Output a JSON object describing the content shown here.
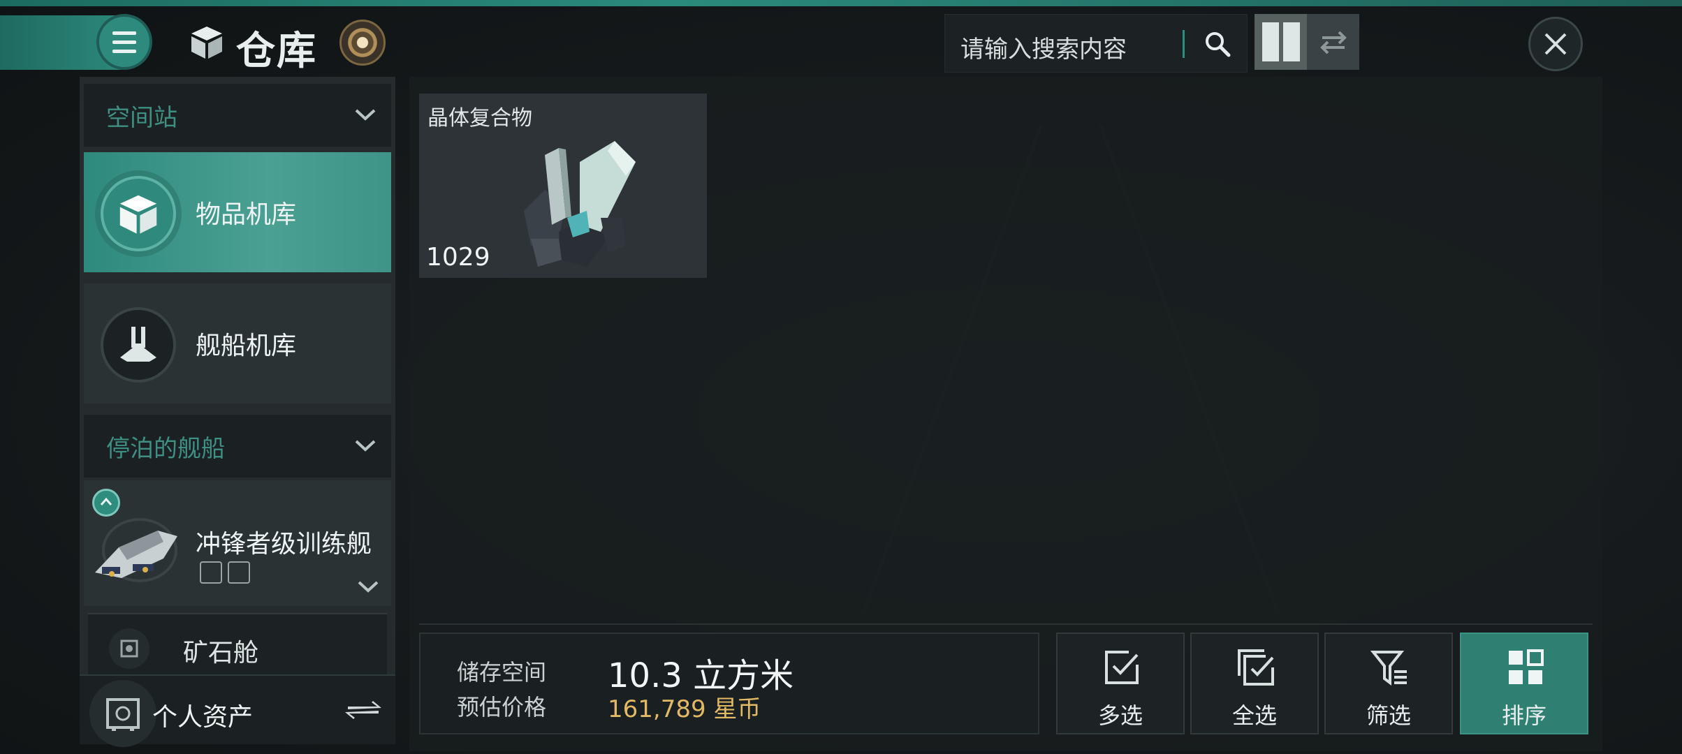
{
  "header": {
    "title": "仓库",
    "search_placeholder": "请输入搜索内容"
  },
  "sidebar": {
    "sections": [
      {
        "label": "空间站"
      },
      {
        "label": "停泊的舰船"
      }
    ],
    "items": [
      {
        "label": "物品机库",
        "icon": "cube-icon",
        "active": true
      },
      {
        "label": "舰船机库",
        "icon": "ship-hangar-icon",
        "active": false
      }
    ],
    "ship": {
      "name": "冲锋者级训练舰"
    },
    "ore": {
      "label": "矿石舱"
    },
    "assets": {
      "label": "个人资产"
    }
  },
  "inventory": {
    "items": [
      {
        "name": "晶体复合物",
        "count": "1029"
      }
    ]
  },
  "storage": {
    "space_label": "储存空间",
    "price_label": "预估价格",
    "volume": "10.3 立方米",
    "price": "161,789 星币"
  },
  "actions": [
    {
      "label": "多选",
      "icon": "check-box-icon"
    },
    {
      "label": "全选",
      "icon": "double-check-icon"
    },
    {
      "label": "筛选",
      "icon": "filter-icon"
    },
    {
      "label": "排序",
      "icon": "sort-grid-icon"
    }
  ],
  "colors": {
    "accent": "#2f8d80",
    "price": "#e2b965"
  }
}
